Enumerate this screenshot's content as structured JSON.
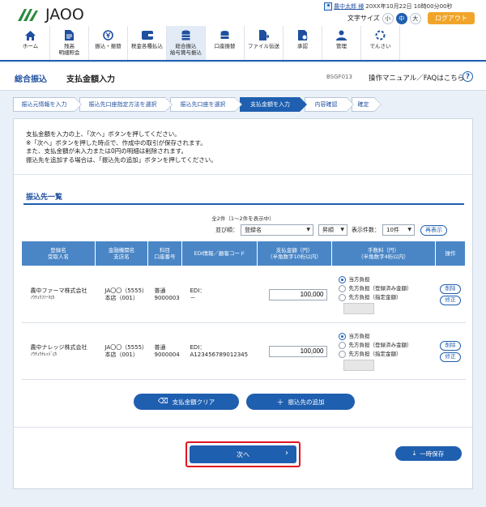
{
  "header": {
    "logo": "JAOO",
    "username": "農中太郎 様",
    "datetime": "20XX年10月22日 10時00分00秒",
    "fontsize_label": "文字サイズ",
    "fontsize_small": "小",
    "fontsize_medium": "中",
    "fontsize_large": "大",
    "logout": "ログアウト"
  },
  "menu": [
    {
      "label": "ホーム",
      "icon": "home-icon"
    },
    {
      "label": "残高\n明細照会",
      "icon": "document-icon"
    },
    {
      "label": "振込・振替",
      "icon": "yen-transfer-icon"
    },
    {
      "label": "税金各種払込",
      "icon": "wallet-icon"
    },
    {
      "label": "総合振込\n給与賞与振込",
      "icon": "coin-stack-icon"
    },
    {
      "label": "口座振替",
      "icon": "coins-icon"
    },
    {
      "label": "ファイル伝送",
      "icon": "file-transfer-icon"
    },
    {
      "label": "承認",
      "icon": "approval-icon"
    },
    {
      "label": "管理",
      "icon": "admin-icon"
    },
    {
      "label": "でんさい",
      "icon": "densai-icon"
    }
  ],
  "title": {
    "main": "総合振込",
    "sub": "支払金額入力",
    "screen_id": "BSGF013",
    "manual": "操作マニュアル／FAQはこちら"
  },
  "steps": [
    "振込元情報を入力",
    "振込先口座指定方法を選択",
    "振込先口座を選択",
    "支払金額を入力",
    "内容確認",
    "確定"
  ],
  "notes": [
    "支払金額を入力の上、「次へ」ボタンを押してください。",
    "※「次へ」ボタンを押した時点で、作成中の取引が保存されます。",
    "また、支払金額が未入力または0円の明細は削除されます。",
    "振込先を追加する場合は、「振込先の追加」ボタンを押してください。"
  ],
  "list": {
    "title": "振込先一覧",
    "count": "全2件（1〜2件を表示中）",
    "sort_label": "並び順：",
    "sort_value": "登録名",
    "order_value": "昇順",
    "per_page_label": "表示件数：",
    "per_page_value": "10件",
    "redisplay": "再表示",
    "headers": {
      "name": "登録名\n受取人名",
      "bank": "金融機関名\n支店名",
      "account": "科目\n口座番号",
      "edi": "EDI情報／顧客コード",
      "amount": "支払金額（円）\n（半角数字10桁以内）",
      "fee": "手数料（円）\n（半角数字4桁以内）",
      "ops": "操作"
    },
    "rows": [
      {
        "name": "農中ファーマ株式会社",
        "kana": "ﾉｳﾁｭｳﾌｧｰﾏ(ｶ",
        "bank": "JA〇〇（5555）",
        "branch": "本店（001）",
        "type": "普通",
        "number": "9000003",
        "edi_label": "EDI：",
        "edi": "－",
        "amount": "100,000"
      },
      {
        "name": "農中ナレッジ株式会社",
        "kana": "ﾉｳﾁｭｳﾅﾚｯｼﾞ(ｶ",
        "bank": "JA〇〇（5555）",
        "branch": "本店（001）",
        "type": "普通",
        "number": "9000004",
        "edi_label": "EDI：",
        "edi": "A123456789012345",
        "amount": "100,000"
      }
    ],
    "fee_options": [
      "当方負担",
      "先方負担（登録済み金額）",
      "先方負担（指定金額）"
    ],
    "delete": "削除",
    "edit": "修正"
  },
  "buttons": {
    "clear": "支払金額クリア",
    "add": "振込先の追加",
    "next": "次へ",
    "save": "一時保存"
  },
  "colors": {
    "accent": "#1f5fb0",
    "header_bg": "#4a86c6",
    "logout": "#f0a52a",
    "highlight": "#e0141e"
  }
}
